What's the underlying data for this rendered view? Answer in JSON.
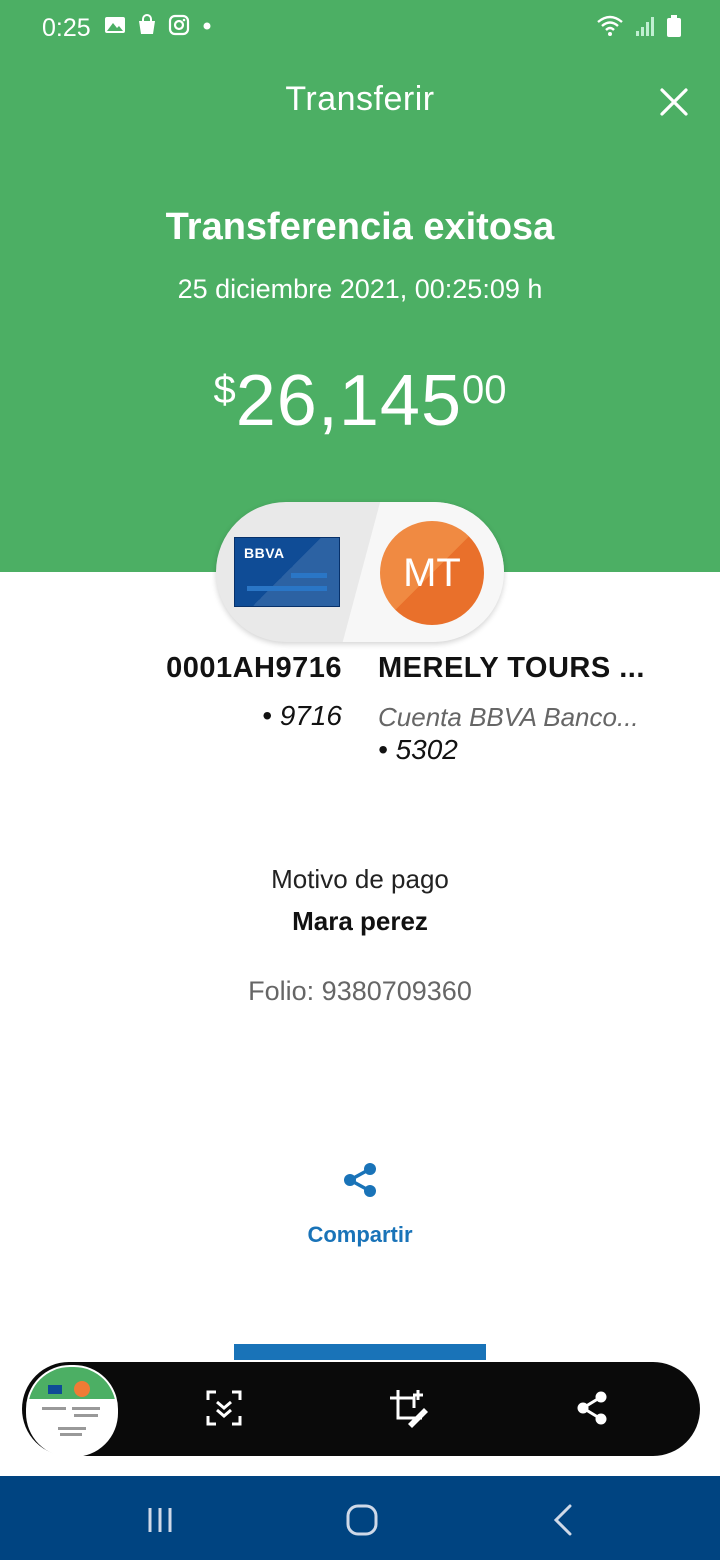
{
  "status_bar": {
    "time": "0:25",
    "left_icons": [
      "image-icon",
      "shopping-bag-icon",
      "instagram-icon",
      "dot-icon"
    ],
    "right_icons": [
      "wifi-icon",
      "signal-icon",
      "battery-icon"
    ]
  },
  "header": {
    "title": "Transferir",
    "close_icon": "close-icon"
  },
  "result": {
    "title": "Transferencia exitosa",
    "datetime": "25 diciembre 2021, 00:25:09 h",
    "amount_currency": "$",
    "amount_integer": "26,145",
    "amount_cents": "00"
  },
  "origin": {
    "card_brand": "BBVA",
    "account_name": "0001AH9716",
    "account_number": "• 9716"
  },
  "destination": {
    "initials": "MT",
    "name": "MERELY TOURS ...",
    "bank": "Cuenta BBVA Banco...",
    "account_number": "• 5302"
  },
  "details": {
    "motivo_label": "Motivo de pago",
    "motivo_value": "Mara perez",
    "folio": "Folio: 9380709360"
  },
  "share": {
    "label": "Compartir",
    "icon": "share-icon"
  },
  "screenshot_toolbar": {
    "icons": [
      "thumbnail-preview",
      "scroll-capture-icon",
      "crop-edit-icon",
      "share-icon"
    ]
  },
  "nav_bar": {
    "icons": [
      "recent-apps-icon",
      "home-icon",
      "back-icon"
    ]
  },
  "colors": {
    "header_green": "#4caf64",
    "bbva_blue": "#0f4c96",
    "link_blue": "#1973b8",
    "avatar_orange": "#ef7b35",
    "nav_blue": "#004481"
  }
}
